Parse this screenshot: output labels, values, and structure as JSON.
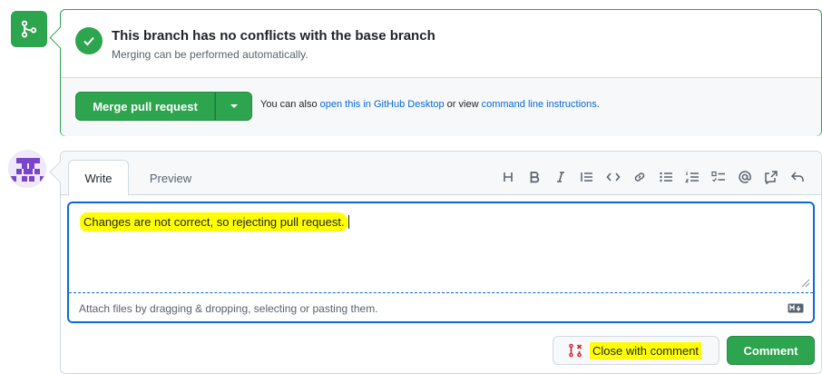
{
  "merge_status": {
    "title": "This branch has no conflicts with the base branch",
    "subtitle": "Merging can be performed automatically.",
    "merge_button_label": "Merge pull request",
    "also_prefix": "You can also ",
    "desktop_link": "open this in GitHub Desktop",
    "also_middle": " or view ",
    "cli_link": "command line instructions",
    "also_suffix": ".",
    "icons": [
      "git-merge-icon",
      "check-icon",
      "triangle-down-icon"
    ]
  },
  "comment": {
    "tabs": [
      "Write",
      "Preview"
    ],
    "toolbar": [
      "heading",
      "bold",
      "italic",
      "quote",
      "code",
      "link",
      "unordered-list",
      "ordered-list",
      "task-list",
      "mention",
      "cross-reference",
      "reply"
    ],
    "text": "Changes are not correct, so rejecting pull request.",
    "attach_hint": "Attach files by dragging & dropping, selecting or pasting them.",
    "close_button_label": "Close with comment",
    "comment_button_label": "Comment"
  },
  "colors": {
    "green": "#2da44e",
    "link": "#0969da",
    "highlight": "#ffff00",
    "close_icon": "#cf222e"
  }
}
